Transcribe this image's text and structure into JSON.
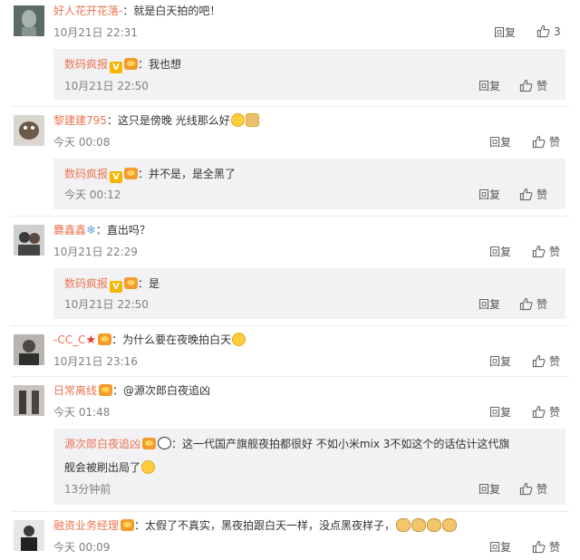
{
  "ui": {
    "reply_label": "回复",
    "like_label": "赞"
  },
  "comments": [
    {
      "user": "好人花开花落-",
      "text": "：就是白天拍的吧！",
      "time": "10月21日 22:31",
      "likes": "3",
      "reply": {
        "user": "数码疯报",
        "text": "：我也想",
        "time": "10月21日 22:50"
      }
    },
    {
      "user": "黎建建795",
      "text": "：这只是傍晚 光线那么好",
      "time": "今天 00:08",
      "reply": {
        "user": "数码疯报",
        "text": "：并不是，是全黑了",
        "time": "今天 00:12"
      }
    },
    {
      "user": "爨鑫鑫",
      "text": "：直出吗？",
      "time": "10月21日 22:29",
      "reply": {
        "user": "数码疯报",
        "text": "：是",
        "time": "10月21日 22:50"
      }
    },
    {
      "user": "-CC_C",
      "text": "：为什么要在夜晚拍白天",
      "time": "10月21日 23:16"
    },
    {
      "user": "日常离线",
      "text": "：@源次郎白夜追凶",
      "time": "今天 01:48",
      "reply": {
        "user": "源次郎白夜追凶",
        "text": "：这一代国产旗舰夜拍都很好 不如小米mix 3不如这个的话估计这代旗",
        "text2": "舰会被刷出局了",
        "time": "13分钟前"
      }
    },
    {
      "user": "融资业务经理",
      "text": "：太假了不真实，黑夜拍跟白天一样，没点黑夜样子，",
      "time": "今天 00:09"
    }
  ],
  "colors": {
    "username": "#eb7350",
    "reply_bg": "#f2f2f5",
    "divider": "#ececec",
    "time": "#808080"
  },
  "icons": [
    "thumbs-up-icon",
    "verified-v-icon",
    "vip-crown-icon",
    "laugh-cry-emoji",
    "red-star-icon",
    "snowflake-icon",
    "panda-emoji",
    "doge-emoji"
  ]
}
